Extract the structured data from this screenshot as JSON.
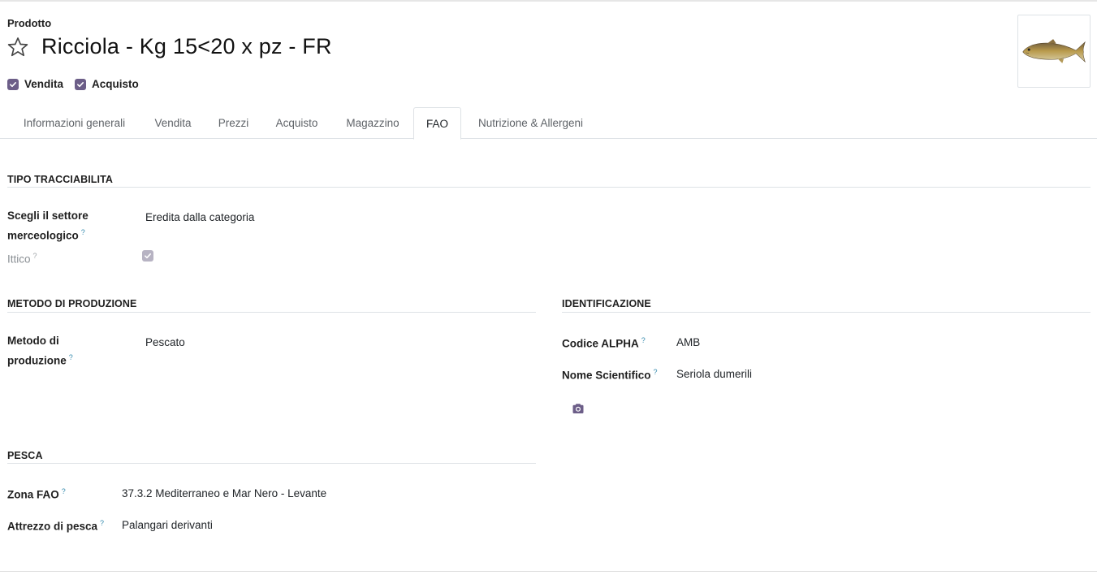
{
  "header": {
    "label": "Prodotto",
    "title": "Ricciola - Kg 15<20 x pz - FR",
    "checkboxes": [
      {
        "label": "Vendita",
        "checked": true
      },
      {
        "label": "Acquisto",
        "checked": true
      }
    ],
    "image_icon": "fish-image"
  },
  "tabs": [
    {
      "label": "Informazioni generali",
      "active": false
    },
    {
      "label": "Vendita",
      "active": false
    },
    {
      "label": "Prezzi",
      "active": false
    },
    {
      "label": "Acquisto",
      "active": false
    },
    {
      "label": "Magazzino",
      "active": false
    },
    {
      "label": "FAO",
      "active": true
    },
    {
      "label": "Nutrizione & Allergeni",
      "active": false
    }
  ],
  "tipo_tracciabilita": {
    "title": "TIPO TRACCIABILITA",
    "settore_label_line1": "Scegli il settore",
    "settore_label_line2": "merceologico",
    "settore_value": "Eredita dalla categoria",
    "ittico_label": "Ittico",
    "ittico_checked": true
  },
  "metodo_produzione": {
    "title": "METODO DI PRODUZIONE",
    "label_line1": "Metodo di",
    "label_line2": "produzione",
    "value": "Pescato"
  },
  "identificazione": {
    "title": "IDENTIFICAZIONE",
    "alpha_label": "Codice ALPHA",
    "alpha_value": "AMB",
    "scientifico_label": "Nome Scientifico",
    "scientifico_value": "Seriola dumerili",
    "camera_icon": "camera-icon"
  },
  "pesca": {
    "title": "PESCA",
    "zona_label": "Zona FAO",
    "zona_value": "37.3.2 Mediterraneo e Mar Nero - Levante",
    "attrezzo_label": "Attrezzo di pesca",
    "attrezzo_value": "Palangari derivanti"
  },
  "colors": {
    "accent": "#6c5e88",
    "help": "#3a8db0",
    "border": "#dee2e6"
  },
  "help_mark": "?"
}
